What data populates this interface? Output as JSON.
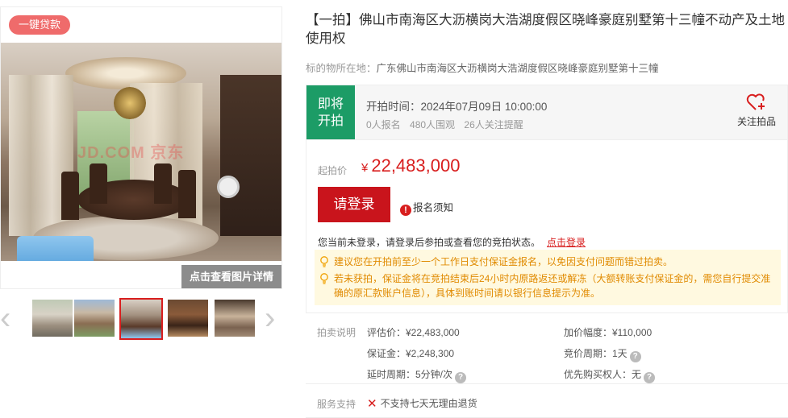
{
  "gallery": {
    "loan_badge": "一键贷款",
    "watermark": "JD.COM 京东",
    "detail_link": "点击查看图片详情",
    "prev_arrow": "‹",
    "next_arrow": "›",
    "thumbnails_count": 5,
    "active_thumbnail": 3
  },
  "item": {
    "title": "【一拍】佛山市南海区大沥横岗大浩湖度假区晓峰豪庭别墅第十三幢不动产及土地使用权",
    "location_label": "标的物所在地：",
    "location_value": "广东佛山市南海区大沥横岗大浩湖度假区晓峰豪庭别墅第十三幢"
  },
  "status": {
    "tag_line1": "即将",
    "tag_line2": "开拍",
    "start_time": "开拍时间：2024年07月09日 10:00:00",
    "stats": [
      "0人报名",
      "480人围观",
      "26人关注提醒"
    ],
    "follow_label": "关注拍品",
    "tag_color": "#1c9c66"
  },
  "price": {
    "start_label": "起拍价",
    "currency": "¥",
    "start_value": "22,483,000",
    "login_button": "请登录",
    "notice_label": "报名须知",
    "login_status_text": "您当前未登录，请登录后参拍或查看您的竞拍状态。",
    "login_link": "点击登录",
    "tips": [
      "建议您在开拍前至少一个工作日支付保证金报名，以免因支付问题而错过拍卖。",
      "若未获拍，保证金将在竞拍结束后24小时内原路返还或解冻（大额转账支付保证金的，需您自行提交准确的原汇款账户信息），具体到账时间请以银行信息提示为准。"
    ],
    "accent_color": "#d81e1e"
  },
  "description": {
    "label": "拍卖说明",
    "appraisal": "评估价：¥22,483,000",
    "increment": "加价幅度：¥110,000",
    "deposit": "保证金：¥2,248,300",
    "cycle": "竞价周期：1天",
    "delay": "延时周期：5分钟/次",
    "priority": "优先购买权人：无"
  },
  "service": {
    "label": "服务支持",
    "item": "不支持七天无理由退货"
  }
}
